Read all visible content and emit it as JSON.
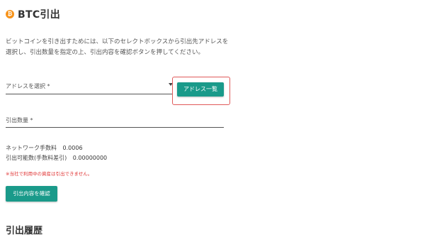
{
  "header": {
    "icon": "bitcoin-icon",
    "icon_glyph": "₿",
    "title": "BTC引出"
  },
  "description": {
    "line1": "ビットコインを引き出すためには、以下のセレクトボックスから引出先アドレスを",
    "line2": "選択し、引出数量を指定の上、引出内容を確認ボタンを押してください。"
  },
  "form": {
    "address_select_label": "アドレスを選択 *",
    "address_list_button": "アドレス一覧",
    "amount_label": "引出数量 *"
  },
  "info": {
    "network_fee_label": "ネットワーク手数料",
    "network_fee_value": "0.0006",
    "available_label": "引出可能数(手数料差引)",
    "available_value": "0.00000000"
  },
  "warning": "※当社で利用中の資産は引出できません。",
  "buttons": {
    "confirm_label": "引出内容を確認"
  },
  "history": {
    "title": "引出履歴"
  },
  "colors": {
    "accent": "#1a9a8a",
    "btc": "#f7931a",
    "highlight": "#e05a5a",
    "warning": "#e03535"
  }
}
